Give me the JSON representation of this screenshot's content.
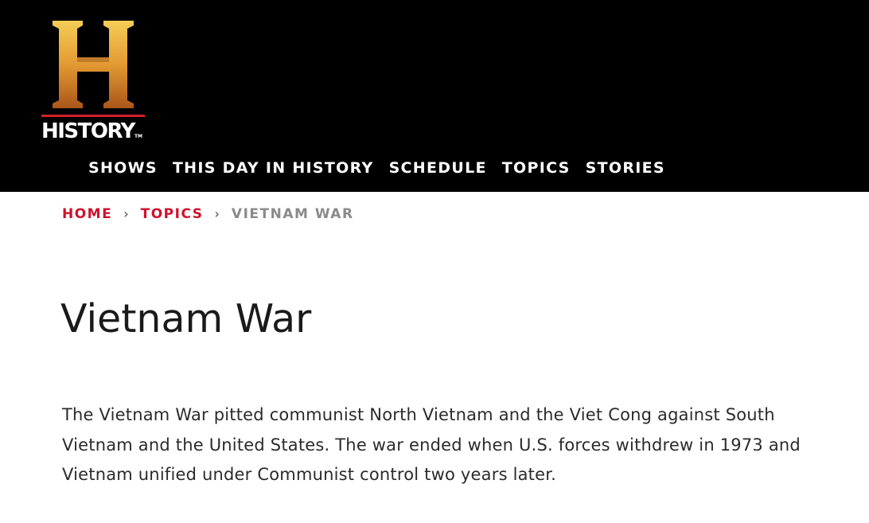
{
  "logo": {
    "word": "HISTORY",
    "tm": "TM",
    "colors": {
      "gold_top": "#f2c14a",
      "gold_bottom": "#a9561a",
      "rule": "#d62027"
    }
  },
  "nav": {
    "items": [
      {
        "label": "SHOWS"
      },
      {
        "label": "THIS DAY IN HISTORY"
      },
      {
        "label": "SCHEDULE"
      },
      {
        "label": "TOPICS"
      },
      {
        "label": "STORIES"
      }
    ]
  },
  "breadcrumb": {
    "items": [
      {
        "label": "HOME"
      },
      {
        "label": "TOPICS"
      },
      {
        "label": "VIETNAM WAR"
      }
    ],
    "separator": "›"
  },
  "page": {
    "title": "Vietnam War",
    "intro": "The Vietnam War pitted communist North Vietnam and the Viet Cong against South Vietnam and the United States. The war ended when U.S. forces withdrew in 1973 and Vietnam unified under Communist control two years later."
  },
  "colors": {
    "header_bg": "#000000",
    "accent_red": "#d0112b",
    "breadcrumb_current": "#8a8a8a",
    "text": "#2b2b2b"
  }
}
